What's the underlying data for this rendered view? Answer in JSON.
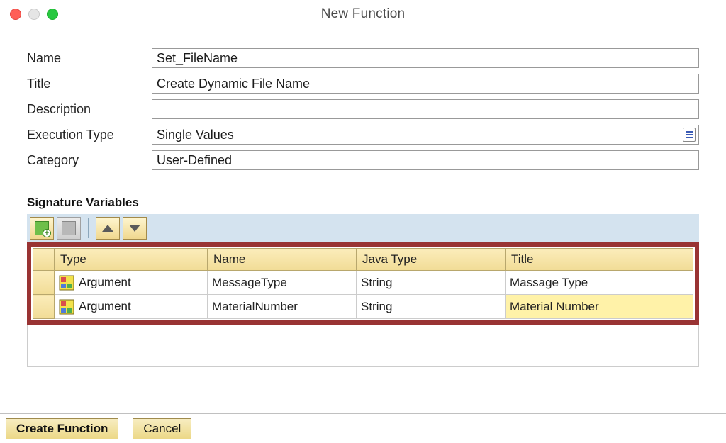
{
  "window": {
    "title": "New Function"
  },
  "form": {
    "name_label": "Name",
    "name_value": "Set_FileName",
    "title_label": "Title",
    "title_value": "Create Dynamic File Name",
    "description_label": "Description",
    "description_value": "",
    "exectype_label": "Execution Type",
    "exectype_value": "Single Values",
    "category_label": "Category",
    "category_value": "User-Defined"
  },
  "section": {
    "signature_vars": "Signature Variables"
  },
  "table": {
    "headers": {
      "type": "Type",
      "name": "Name",
      "java": "Java Type",
      "title": "Title"
    },
    "rows": [
      {
        "type": "Argument",
        "name": "MessageType",
        "java": "String",
        "title": "Massage Type",
        "selected": false
      },
      {
        "type": "Argument",
        "name": "MaterialNumber",
        "java": "String",
        "title": "Material Number",
        "selected": true
      }
    ]
  },
  "buttons": {
    "create": "Create Function",
    "cancel": "Cancel"
  }
}
